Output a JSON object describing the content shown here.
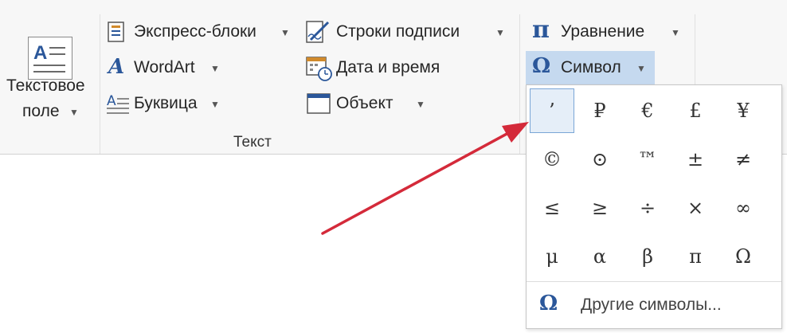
{
  "text_group": {
    "label": "Текст",
    "textbox_line1": "Текстовое",
    "textbox_line2": "поле",
    "quick_parts": "Экспресс-блоки",
    "wordart": "WordArt",
    "dropcap": "Буквица",
    "signature_line": "Строки подписи",
    "date_time": "Дата и время",
    "object": "Объект"
  },
  "symbols_group": {
    "equation": "Уравнение",
    "symbol": "Символ",
    "pi_glyph": "π",
    "omega_glyph": "Ω"
  },
  "symbol_panel": {
    "cells": [
      "’",
      "₽",
      "€",
      "£",
      "¥",
      "©",
      "⊙",
      "™",
      "±",
      "≠",
      "≤",
      "≥",
      "÷",
      "×",
      "∞",
      "μ",
      "α",
      "β",
      "π",
      "Ω"
    ],
    "more_symbols": "Другие символы...",
    "more_icon_glyph": "Ω"
  },
  "icons": [
    "textbox-icon",
    "quick-parts-icon",
    "wordart-icon",
    "dropcap-icon",
    "signature-line-icon",
    "date-time-icon",
    "object-icon",
    "pi-icon",
    "omega-icon"
  ],
  "colors": {
    "accent": "#2b579a",
    "highlight": "#c5d9ef",
    "arrow": "#d42a3a"
  }
}
